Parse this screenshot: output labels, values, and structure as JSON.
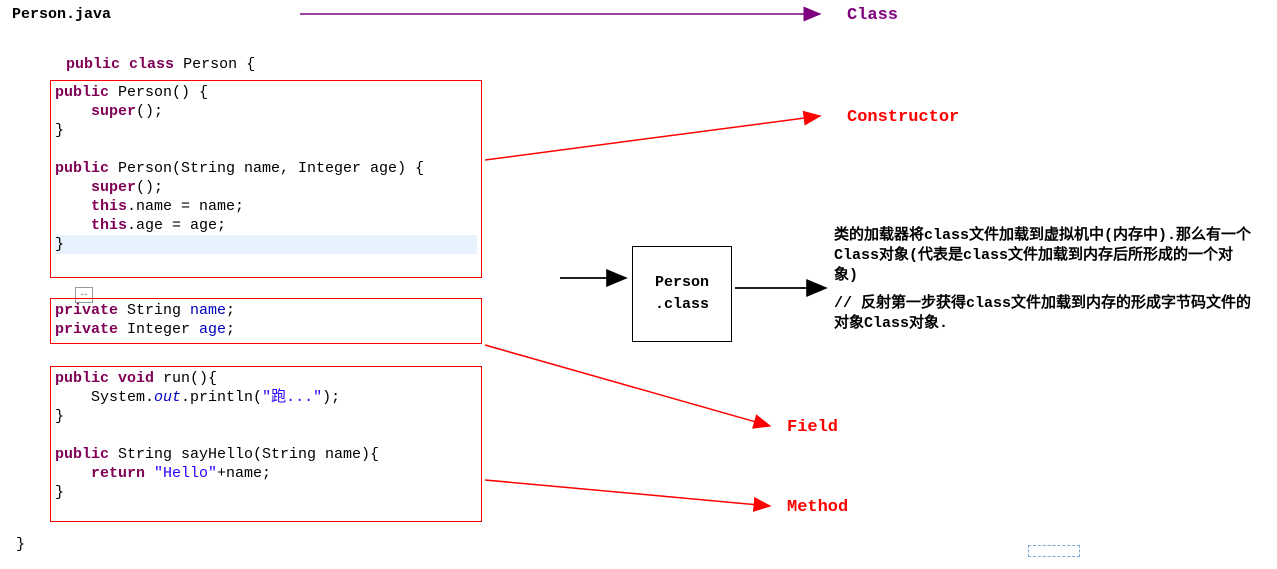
{
  "file": {
    "name": "Person.java"
  },
  "decl": {
    "kw_public": "public",
    "kw_class": "class",
    "name": "Person",
    "open": "{",
    "close": "}"
  },
  "ctor": {
    "l1a": "public",
    "l1b": " Person() {",
    "l2a": "    super",
    "l2b": "();",
    "l3": "}",
    "blank": "",
    "l4a": "public",
    "l4b": " Person(String name, Integer age) {",
    "l5a": "    super",
    "l5b": "();",
    "l6a": "    this",
    "l6b": ".name = name;",
    "l7a": "    this",
    "l7b": ".age = age;",
    "l8": "}"
  },
  "fields": {
    "l1a": "private",
    "l1b": " String ",
    "l1c": "name",
    "l1d": ";",
    "l2a": "private",
    "l2b": " Integer ",
    "l2c": "age",
    "l2d": ";"
  },
  "methods": {
    "l1a": "public",
    "l1b": " void",
    "l1c": " run(){",
    "l2a": "    System.",
    "l2b": "out",
    "l2c": ".println(",
    "l2d": "\"跑...\"",
    "l2e": ");",
    "l3": "}",
    "blank": "",
    "l4a": "public",
    "l4b": " String sayHello(String name){",
    "l5a": "    return ",
    "l5b": "\"Hello\"",
    "l5c": "+name;",
    "l6": "}"
  },
  "classbox": {
    "l1": "Person",
    "l2": ".class"
  },
  "labels": {
    "class": "Class",
    "constructor": "Constructor",
    "field": "Field",
    "method": "Method"
  },
  "explain": {
    "p1": "类的加载器将class文件加载到虚拟机中(内存中).那么有一个Class对象(代表是class文件加载到内存后所形成的一个对象)",
    "p2": "// 反射第一步获得class文件加载到内存的形成字节码文件的对象Class对象."
  },
  "handle": "↔"
}
